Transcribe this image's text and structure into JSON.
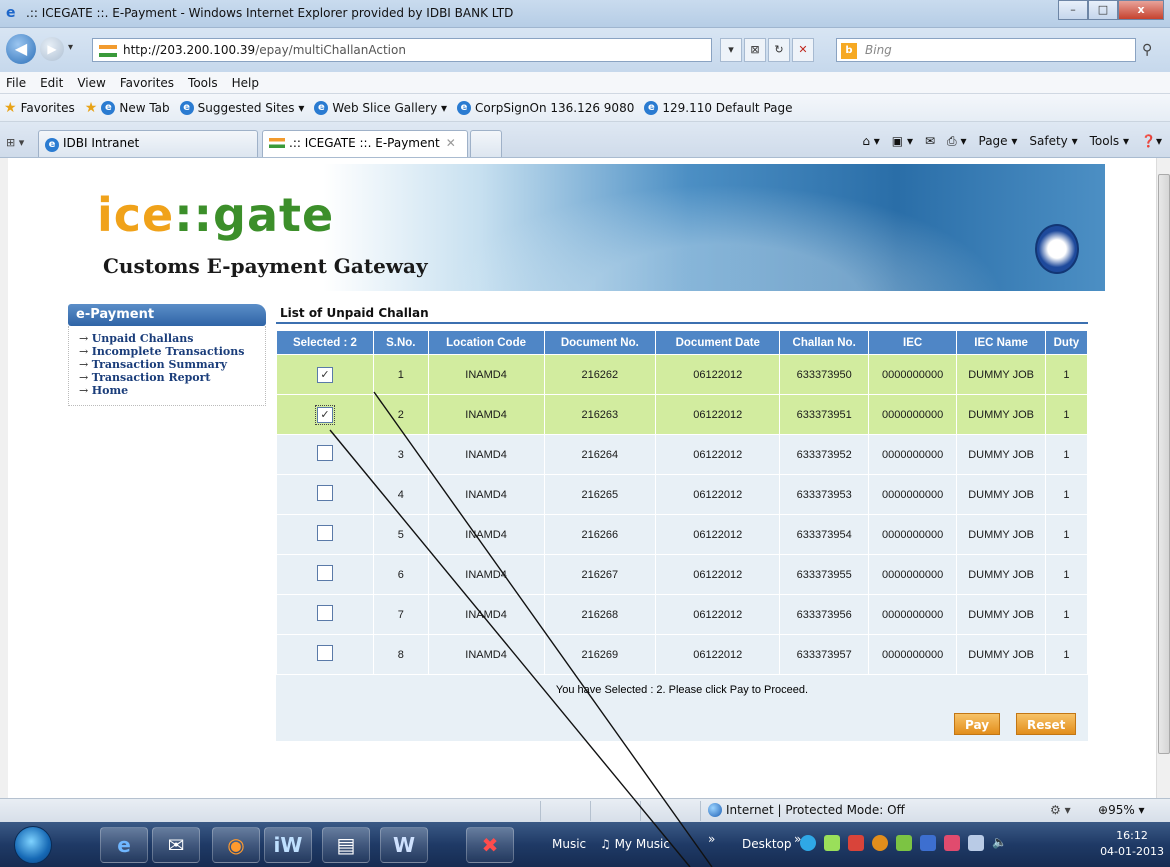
{
  "window": {
    "title": ".:: ICEGATE ::. E-Payment - Windows Internet Explorer provided by IDBI BANK LTD",
    "min_label": "–",
    "max_label": "□",
    "close_label": "x"
  },
  "address": {
    "host": "http://203.200.100.39",
    "path": "/epay/multiChallanAction",
    "search_placeholder": "Bing",
    "bing_letter": "b"
  },
  "menu": [
    "File",
    "Edit",
    "View",
    "Favorites",
    "Tools",
    "Help"
  ],
  "favorites": {
    "label": "Favorites",
    "items": [
      "New Tab",
      "Suggested Sites ▾",
      "Web Slice Gallery ▾",
      "CorpSignOn 136.126 9080",
      "129.110 Default Page"
    ]
  },
  "tabs": [
    {
      "label": "IDBI Intranet"
    },
    {
      "label": ".:: ICEGATE ::. E-Payment"
    }
  ],
  "commandbar": [
    "Page ▾",
    "Safety ▾",
    "Tools ▾"
  ],
  "banner": {
    "logo_ice": "ice",
    "logo_sep": "::",
    "logo_gate": "gate",
    "subtitle": "Customs E-payment Gateway"
  },
  "sidebar": {
    "heading": "e-Payment",
    "items": [
      "Unpaid Challans",
      "Incomplete Transactions",
      "Transaction Summary",
      "Transaction Report",
      "Home"
    ]
  },
  "main": {
    "heading": "List of Unpaid Challan",
    "columns": [
      "Selected : 2",
      "S.No.",
      "Location Code",
      "Document No.",
      "Document Date",
      "Challan No.",
      "IEC",
      "IEC Name",
      "Duty"
    ],
    "rows": [
      {
        "checked": true,
        "sno": "1",
        "loc": "INAMD4",
        "doc": "216262",
        "date": "06122012",
        "challan": "633373950",
        "iec": "0000000000",
        "name": "DUMMY JOB",
        "duty": "1"
      },
      {
        "checked": true,
        "sno": "2",
        "loc": "INAMD4",
        "doc": "216263",
        "date": "06122012",
        "challan": "633373951",
        "iec": "0000000000",
        "name": "DUMMY JOB",
        "duty": "1"
      },
      {
        "checked": false,
        "sno": "3",
        "loc": "INAMD4",
        "doc": "216264",
        "date": "06122012",
        "challan": "633373952",
        "iec": "0000000000",
        "name": "DUMMY JOB",
        "duty": "1"
      },
      {
        "checked": false,
        "sno": "4",
        "loc": "INAMD4",
        "doc": "216265",
        "date": "06122012",
        "challan": "633373953",
        "iec": "0000000000",
        "name": "DUMMY JOB",
        "duty": "1"
      },
      {
        "checked": false,
        "sno": "5",
        "loc": "INAMD4",
        "doc": "216266",
        "date": "06122012",
        "challan": "633373954",
        "iec": "0000000000",
        "name": "DUMMY JOB",
        "duty": "1"
      },
      {
        "checked": false,
        "sno": "6",
        "loc": "INAMD4",
        "doc": "216267",
        "date": "06122012",
        "challan": "633373955",
        "iec": "0000000000",
        "name": "DUMMY JOB",
        "duty": "1"
      },
      {
        "checked": false,
        "sno": "7",
        "loc": "INAMD4",
        "doc": "216268",
        "date": "06122012",
        "challan": "633373956",
        "iec": "0000000000",
        "name": "DUMMY JOB",
        "duty": "1"
      },
      {
        "checked": false,
        "sno": "8",
        "loc": "INAMD4",
        "doc": "216269",
        "date": "06122012",
        "challan": "633373957",
        "iec": "0000000000",
        "name": "DUMMY JOB",
        "duty": "1"
      }
    ],
    "message": "You have Selected : 2. Please click Pay to Proceed.",
    "pay_label": "Pay",
    "reset_label": "Reset"
  },
  "status": {
    "zone": "Internet | Protected Mode: Off",
    "zoom": "95%"
  },
  "taskbar": {
    "music": "Music",
    "my_music": "My Music",
    "desktop": "Desktop",
    "time": "16:12",
    "date": "04-01-2013",
    "iw_label": "iW"
  },
  "colors": {
    "header_blue": "#4f86c6",
    "selected_row": "#d2ec9f",
    "button_orange": "#e28e1c"
  }
}
